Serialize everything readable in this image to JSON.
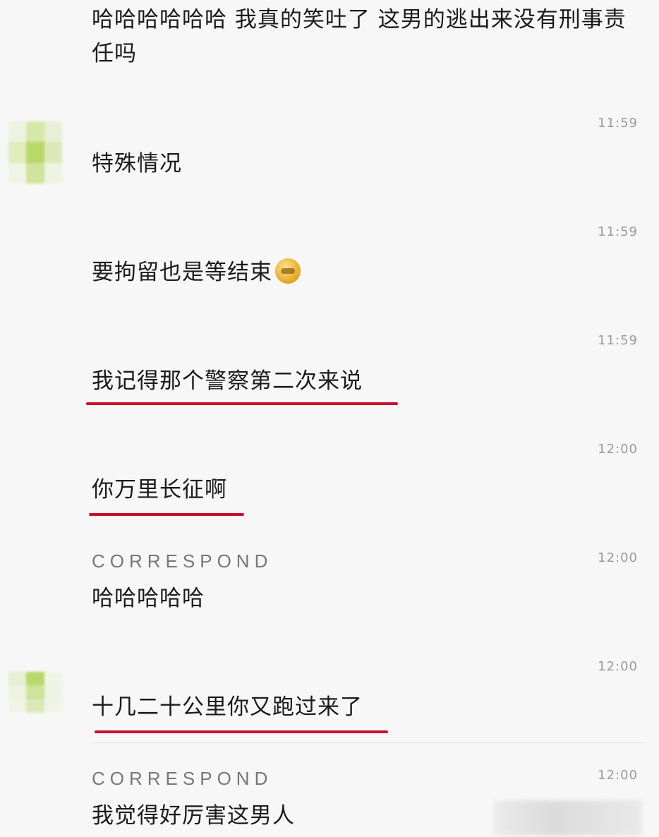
{
  "messages": [
    {
      "text": "哈哈哈哈哈哈 我真的笑吐了 这男的逃出来没有刑事责任吗"
    },
    {
      "time": "11:59",
      "text": "特殊情况"
    },
    {
      "time": "11:59",
      "text": "要拘留也是等结束",
      "emoji": "grimacing-emoji"
    },
    {
      "time": "11:59",
      "text": "我记得那个警察第二次来说"
    },
    {
      "time": "12:00",
      "text": "你万里长征啊"
    },
    {
      "time": "12:00",
      "sender": "CORRESPOND",
      "text": "哈哈哈哈哈"
    },
    {
      "time": "12:00",
      "text": "十几二十公里你又跑过来了"
    },
    {
      "time": "12:00",
      "sender": "CORRESPOND",
      "text": "我觉得好厉害这男人"
    }
  ],
  "colors": {
    "underline": "#c8102e",
    "background": "#f7f7f7",
    "avatar": [
      "#e8efd4",
      "#d6e8a8",
      "#eef3e0",
      "#cfe39a",
      "#b8d86a",
      "#e0ecbc",
      "#eef3e2",
      "#dce9b6",
      "#f0f4e6"
    ]
  }
}
